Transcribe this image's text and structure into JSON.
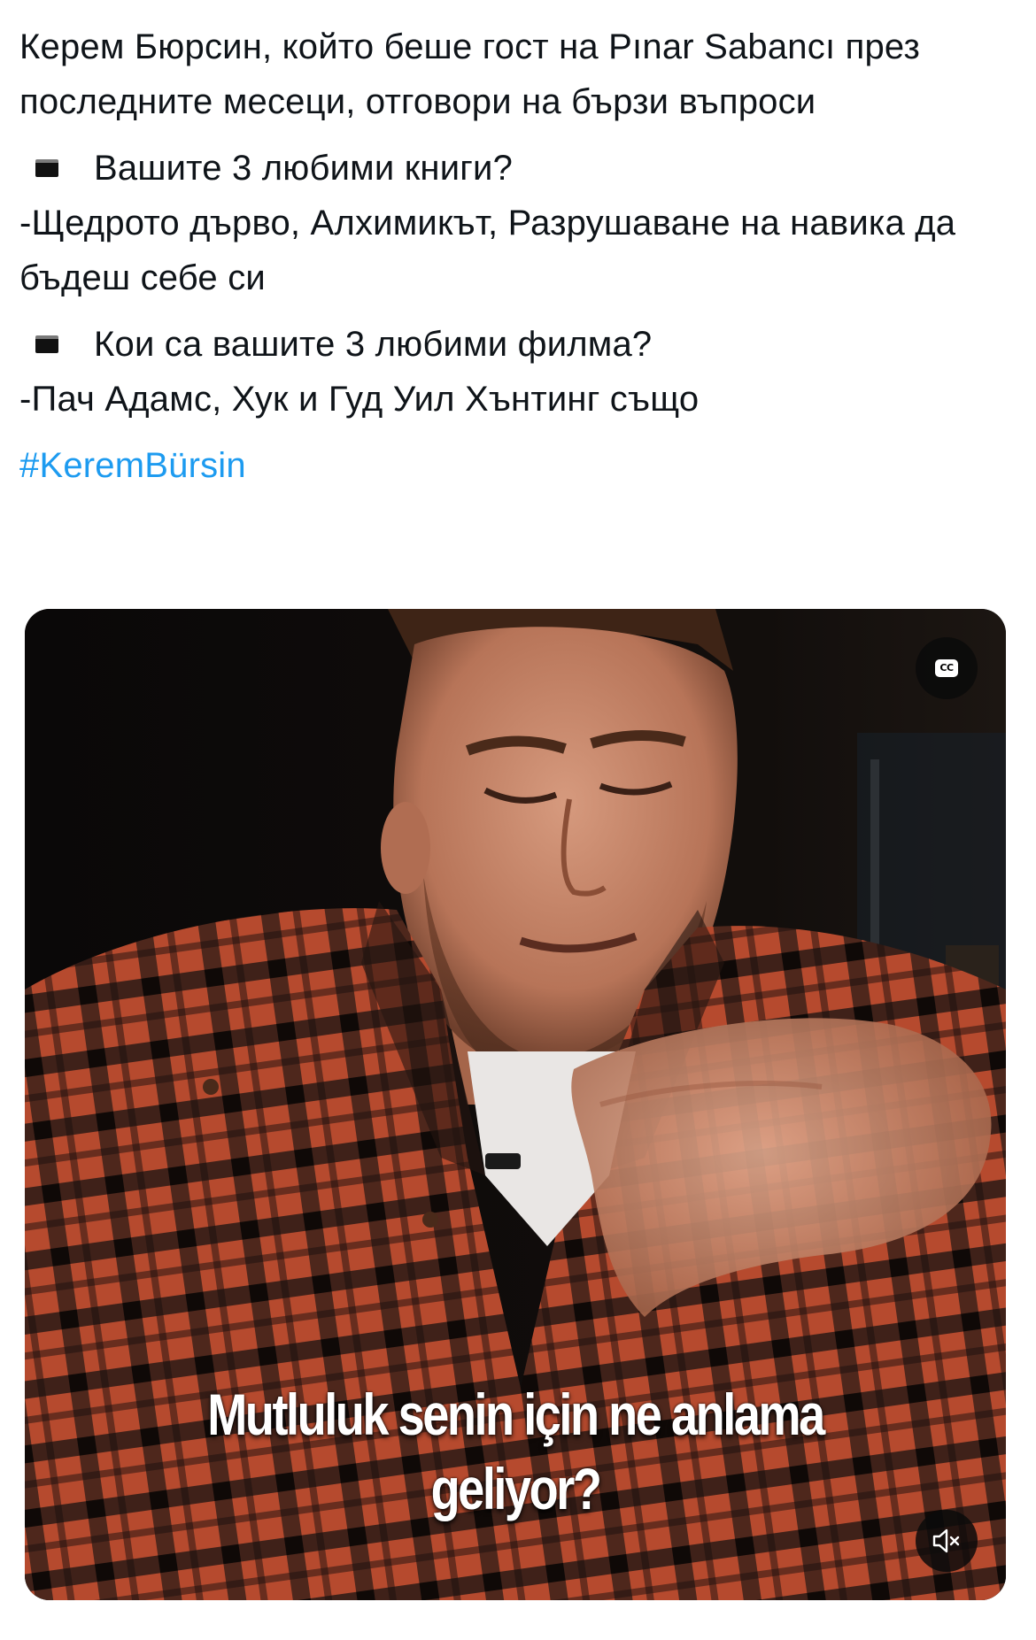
{
  "tweet": {
    "intro": "Керем Бюрсин, който беше гост на Pınar Sabancı през последните месеци, отговори на бързи въпроси",
    "q1": "Вашите 3 любими книги?",
    "a1": "-Щедрото дърво, Алхимикът, Разрушаване на навика да бъдеш себе си",
    "q2": "Кои са вашите 3 любими филма?",
    "a2": "-Пач Адамс, Хук и Гуд Уил Хънтинг също",
    "hashtag": "#KeremBürsin",
    "bullet_icon": "black-square-bullet-icon"
  },
  "video": {
    "subtitle": "Mutluluk senin için ne anlama\ngeliyor?",
    "cc_label": "CC",
    "cc_icon": "closed-captions-icon",
    "mute_icon": "speaker-muted-icon"
  },
  "colors": {
    "text": "#0f1419",
    "link": "#1d9bf0",
    "background": "#ffffff",
    "video_bg": "#0b0908",
    "shirt_red": "#b5472d",
    "shirt_dark": "#1a1412"
  }
}
